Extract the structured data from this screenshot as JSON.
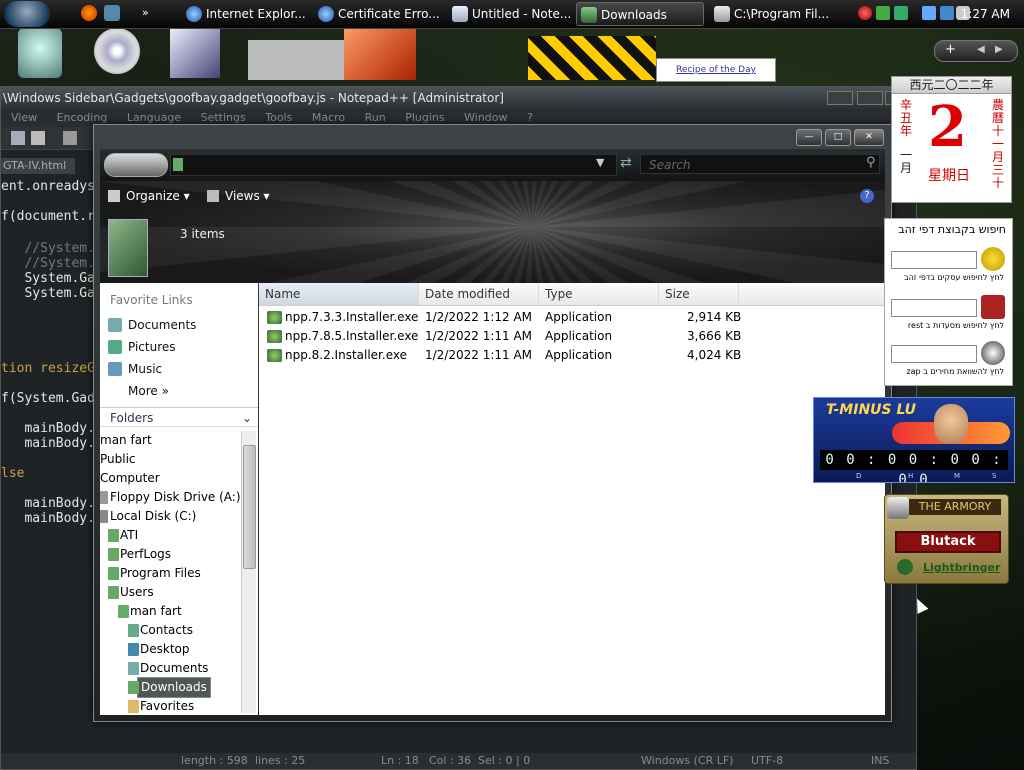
{
  "taskbar": {
    "tasks": [
      {
        "label": "Internet Explor...",
        "icon": "ie-icon"
      },
      {
        "label": "Certificate Erro...",
        "icon": "ie-icon"
      },
      {
        "label": "Untitled - Note...",
        "icon": "notepad-icon"
      },
      {
        "label": "Downloads",
        "icon": "folder-icon"
      },
      {
        "label": "C:\\Program Fil...",
        "icon": "window-icon"
      }
    ],
    "clock": "1:27 AM"
  },
  "recipe_gadget": {
    "label": "Recipe of the Day"
  },
  "npp": {
    "title": "\\Windows Sidebar\\Gadgets\\goofbay.gadget\\goofbay.js - Notepad++ [Administrator]",
    "menu": [
      "View",
      "Encoding",
      "Language",
      "Settings",
      "Tools",
      "Macro",
      "Run",
      "Plugins",
      "Window",
      "?"
    ],
    "tab": "GTA-IV.html",
    "code_lines": [
      "ent.onreadys",
      "f(document.r",
      "",
      "   //System.",
      "   //System.",
      "   System.Ga",
      "   System.Ga",
      "",
      "",
      "",
      "tion resizeG",
      "",
      "f(System.Gad",
      "",
      "   mainBody.",
      "   mainBody.",
      "",
      "lse",
      "",
      "   mainBody.",
      "   mainBody."
    ],
    "status": {
      "length": "length : 598",
      "lines": "lines : 25",
      "ln": "Ln : 18",
      "col": "Col : 36",
      "sel": "Sel : 0 | 0",
      "eol": "Windows (CR LF)",
      "encoding": "UTF-8",
      "ins": "INS"
    }
  },
  "explorer": {
    "search_placeholder": "Search",
    "toolbar": {
      "organize": "Organize",
      "views": "Views"
    },
    "items_count": "3 items",
    "favorite_links_title": "Favorite Links",
    "favorites": [
      {
        "label": "Documents",
        "icon": "documents-icon"
      },
      {
        "label": "Pictures",
        "icon": "pictures-icon"
      },
      {
        "label": "Music",
        "icon": "music-icon"
      },
      {
        "label": "More",
        "icon": "more-icon"
      }
    ],
    "more_suffix": "»",
    "folders_label": "Folders",
    "tree": [
      {
        "label": "man fart",
        "indent": 0
      },
      {
        "label": "Public",
        "indent": 0
      },
      {
        "label": "Computer",
        "indent": 0
      },
      {
        "label": "Floppy Disk Drive (A:)",
        "indent": 1
      },
      {
        "label": "Local Disk (C:)",
        "indent": 1
      },
      {
        "label": "ATI",
        "indent": 2
      },
      {
        "label": "PerfLogs",
        "indent": 2
      },
      {
        "label": "Program Files",
        "indent": 2
      },
      {
        "label": "Users",
        "indent": 2
      },
      {
        "label": "man fart",
        "indent": 3
      },
      {
        "label": "Contacts",
        "indent": 4
      },
      {
        "label": "Desktop",
        "indent": 4
      },
      {
        "label": "Documents",
        "indent": 4
      },
      {
        "label": "Downloads",
        "indent": 4,
        "selected": true
      },
      {
        "label": "Favorites",
        "indent": 4
      }
    ],
    "columns": [
      "Name",
      "Date modified",
      "Type",
      "Size"
    ],
    "files": [
      {
        "name": "npp.7.3.3.Installer.exe",
        "date": "1/2/2022 1:12 AM",
        "type": "Application",
        "size": "2,914 KB"
      },
      {
        "name": "npp.7.8.5.Installer.exe",
        "date": "1/2/2022 1:11 AM",
        "type": "Application",
        "size": "3,666 KB"
      },
      {
        "name": "npp.8.2.Installer.exe",
        "date": "1/2/2022 1:11 AM",
        "type": "Application",
        "size": "4,024 KB"
      }
    ]
  },
  "calendar_gadget": {
    "header": "西元二〇二二年",
    "day": "2",
    "weekday": "星期日",
    "left_col": "辛丑年",
    "left_bottom": "一月",
    "right_col": "農曆十一月三十"
  },
  "hebrew_gadget": {
    "title": "חיפוש בקבוצת דפי זהב",
    "labels": [
      "לחץ לחיפוש עסקים בדפי זהב",
      "לחץ לחיפוש מסעדות ב rest",
      "לחץ להשוואת מחירים ב zap"
    ]
  },
  "tminus_gadget": {
    "title": "T-MINUS LU",
    "digits": "0 0 : 0 0 : 0 0 : 0 0",
    "units": [
      "D",
      "H",
      "M",
      "S"
    ]
  },
  "armory_gadget": {
    "title": "THE ARMORY",
    "character": "Blutack",
    "realm": "Lightbringer"
  },
  "colors": {
    "accent": "#1e2a4a",
    "selection": "#505658",
    "code_keyword": "#c8a24a"
  }
}
